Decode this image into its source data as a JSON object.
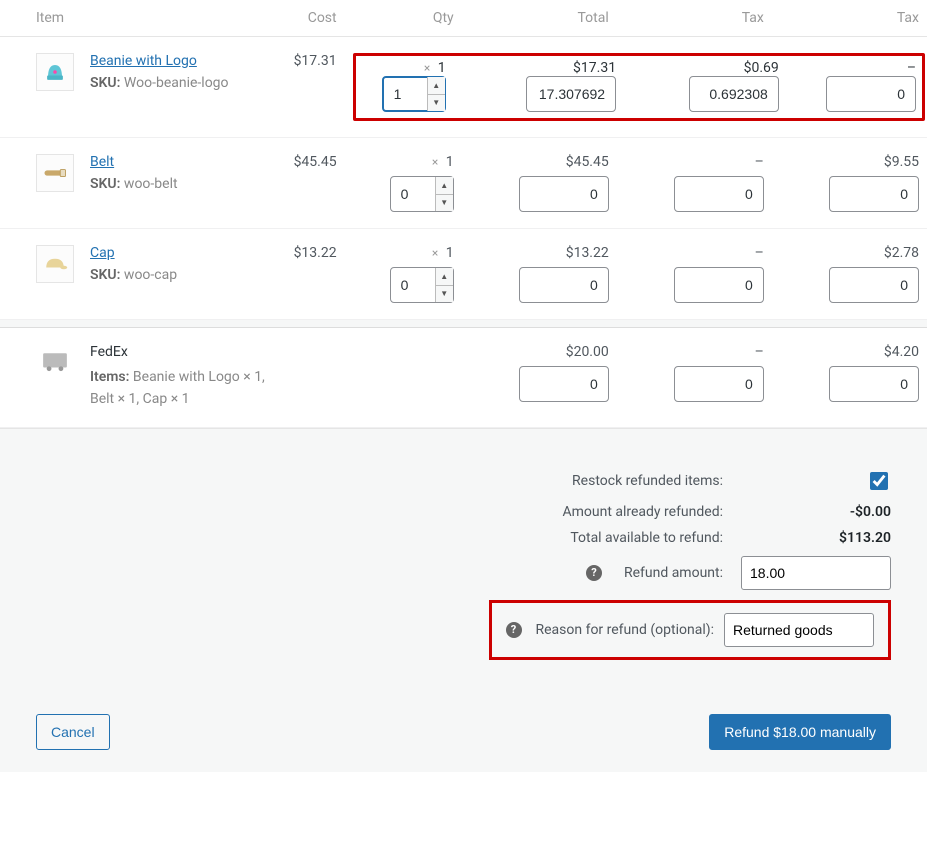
{
  "headers": {
    "item": "Item",
    "cost": "Cost",
    "qty": "Qty",
    "total": "Total",
    "tax1": "Tax",
    "tax2": "Tax"
  },
  "items": [
    {
      "name": "Beanie with Logo",
      "sku_label": "SKU:",
      "sku": "Woo-beanie-logo",
      "cost": "$17.31",
      "qty_prefix": "×",
      "qty": "1",
      "total": "$17.31",
      "tax1": "$0.69",
      "tax2": "–",
      "refund_qty": "1",
      "refund_total": "17.307692",
      "refund_tax1": "0.692308",
      "refund_tax2": "0",
      "highlight": true
    },
    {
      "name": "Belt",
      "sku_label": "SKU:",
      "sku": "woo-belt",
      "cost": "$45.45",
      "qty_prefix": "×",
      "qty": "1",
      "total": "$45.45",
      "tax1": "–",
      "tax2": "$9.55",
      "refund_qty": "0",
      "refund_total": "0",
      "refund_tax1": "0",
      "refund_tax2": "0",
      "highlight": false
    },
    {
      "name": "Cap",
      "sku_label": "SKU:",
      "sku": "woo-cap",
      "cost": "$13.22",
      "qty_prefix": "×",
      "qty": "1",
      "total": "$13.22",
      "tax1": "–",
      "tax2": "$2.78",
      "refund_qty": "0",
      "refund_total": "0",
      "refund_tax1": "0",
      "refund_tax2": "0",
      "highlight": false
    }
  ],
  "shipping": {
    "name": "FedEx",
    "items_label": "Items:",
    "items_text": "Beanie with Logo × 1, Belt × 1, Cap × 1",
    "total": "$20.00",
    "tax1": "–",
    "tax2": "$4.20",
    "refund_total": "0",
    "refund_tax1": "0",
    "refund_tax2": "0"
  },
  "totals": {
    "restock_label": "Restock refunded items:",
    "restock_checked": true,
    "already_label": "Amount already refunded:",
    "already_value": "-$0.00",
    "available_label": "Total available to refund:",
    "available_value": "$113.20",
    "amount_label": "Refund amount:",
    "amount_value": "18.00",
    "reason_label": "Reason for refund (optional):",
    "reason_value": "Returned goods"
  },
  "actions": {
    "cancel": "Cancel",
    "refund": "Refund $18.00 manually"
  }
}
